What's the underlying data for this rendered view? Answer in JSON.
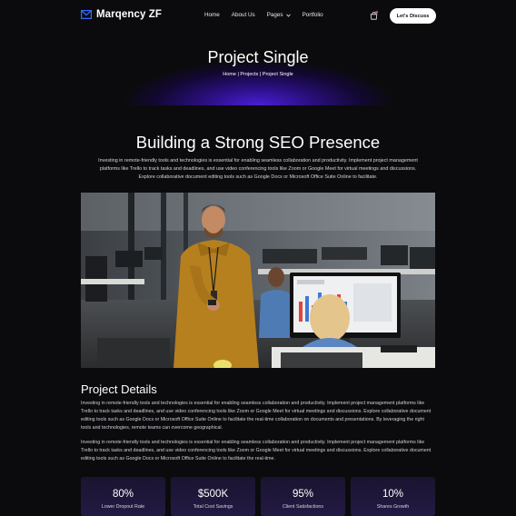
{
  "brand": {
    "name": "Marqency ZF"
  },
  "nav": {
    "items": [
      {
        "label": "Home"
      },
      {
        "label": "About Us"
      },
      {
        "label": "Pages"
      },
      {
        "label": "Portfolio"
      }
    ],
    "cta_label": "Let's Discuss"
  },
  "hero": {
    "title": "Project Single",
    "breadcrumb": [
      "Home",
      "Projects",
      "Project Single"
    ],
    "separator": " | "
  },
  "intro": {
    "heading": "Building a Strong SEO Presence",
    "text": "Investing in remote-friendly tools and technologies is essential for enabling seamless collaboration and productivity. Implement project management platforms like Trello to track tasks and deadlines, and use video conferencing tools like Zoom or Google Meet for virtual meetings and discussions. Explore collaborative document editing tools such as Google Docs or Microsoft Office Suite Online to facilitate."
  },
  "details": {
    "heading": "Project Details",
    "paragraph1": "Investing in remote-friendly tools and technologies is essential for enabling seamless collaboration and productivity. Implement project management platforms like Trello to track tasks and deadlines, and use video conferencing tools like Zoom or Google Meet for virtual meetings and discussions. Explore collaborative document editing tools such as Google Docs or Microsoft Office Suite Online to facilitate the real-time collaboration on documents and presentations. By leveraging the right tools and technologies, remote teams can overcome geographical.",
    "paragraph2": "Investing in remote-friendly tools and technologies is essential for enabling seamless collaboration and productivity. Implement project management platforms like Trello to track tasks and deadlines, and use video conferencing tools like Zoom or Google Meet for virtual meetings and discussions. Explore collaborative document editing tools such as Google Docs or Microsoft Office Suite Online to facilitate the real-time."
  },
  "stats": [
    {
      "value": "80%",
      "label": "Lower Dropout Rate"
    },
    {
      "value": "$500K",
      "label": "Total Cost Savings"
    },
    {
      "value": "95%",
      "label": "Client Satisfactions"
    },
    {
      "value": "10%",
      "label": "Shares Growth"
    }
  ],
  "icons": {
    "logo": "envelope-logo-icon",
    "dropdown": "chevron-down-icon",
    "cart": "shopping-bag-icon"
  },
  "colors": {
    "background": "#0b0b0d",
    "accent": "#4a1ed6",
    "logo_blue": "#2f6bff",
    "stat_card": "#1f1738"
  }
}
